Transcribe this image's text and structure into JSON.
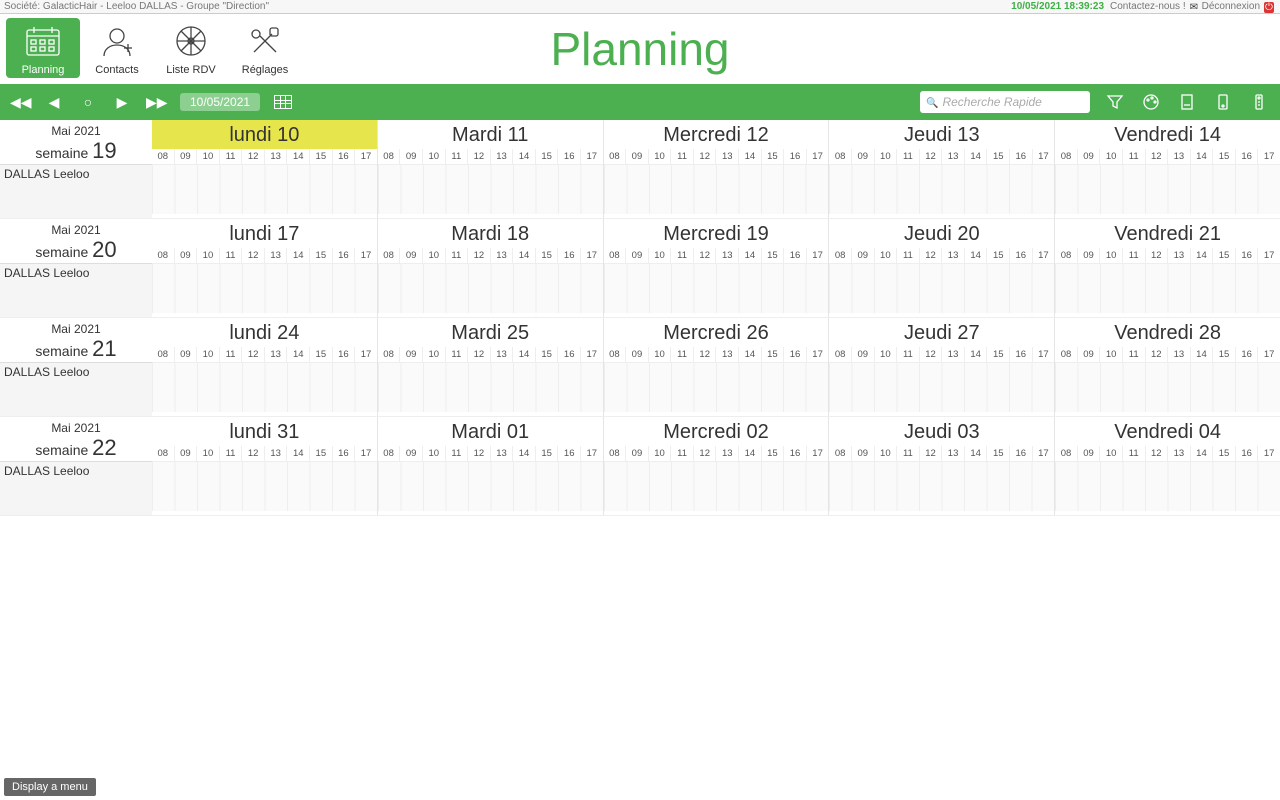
{
  "statusbar": {
    "company": "Société: GalacticHair - Leeloo DALLAS - Groupe \"Direction\"",
    "datetime": "10/05/2021 18:39:23",
    "contact": "Contactez-nous !",
    "logout": "Déconnexion"
  },
  "nav": {
    "planning": "Planning",
    "contacts": "Contacts",
    "listerdv": "Liste RDV",
    "reglages": "Réglages"
  },
  "page_title": "Planning",
  "toolbar": {
    "date": "10/05/2021",
    "search_placeholder": "Recherche Rapide"
  },
  "hours": [
    "08",
    "09",
    "10",
    "11",
    "12",
    "13",
    "14",
    "15",
    "16",
    "17"
  ],
  "weeks": [
    {
      "month": "Mai 2021",
      "label_prefix": "semaine",
      "num": "19",
      "person": "DALLAS Leeloo",
      "today_index": 0,
      "days": [
        "lundi 10",
        "Mardi 11",
        "Mercredi 12",
        "Jeudi 13",
        "Vendredi 14"
      ]
    },
    {
      "month": "Mai 2021",
      "label_prefix": "semaine",
      "num": "20",
      "person": "DALLAS Leeloo",
      "today_index": -1,
      "days": [
        "lundi 17",
        "Mardi 18",
        "Mercredi 19",
        "Jeudi 20",
        "Vendredi 21"
      ]
    },
    {
      "month": "Mai 2021",
      "label_prefix": "semaine",
      "num": "21",
      "person": "DALLAS Leeloo",
      "today_index": -1,
      "days": [
        "lundi 24",
        "Mardi 25",
        "Mercredi 26",
        "Jeudi 27",
        "Vendredi 28"
      ]
    },
    {
      "month": "Mai 2021",
      "label_prefix": "semaine",
      "num": "22",
      "person": "DALLAS Leeloo",
      "today_index": -1,
      "days": [
        "lundi 31",
        "Mardi 01",
        "Mercredi 02",
        "Jeudi 03",
        "Vendredi 04"
      ]
    }
  ],
  "footer": {
    "menu": "Display a menu"
  }
}
